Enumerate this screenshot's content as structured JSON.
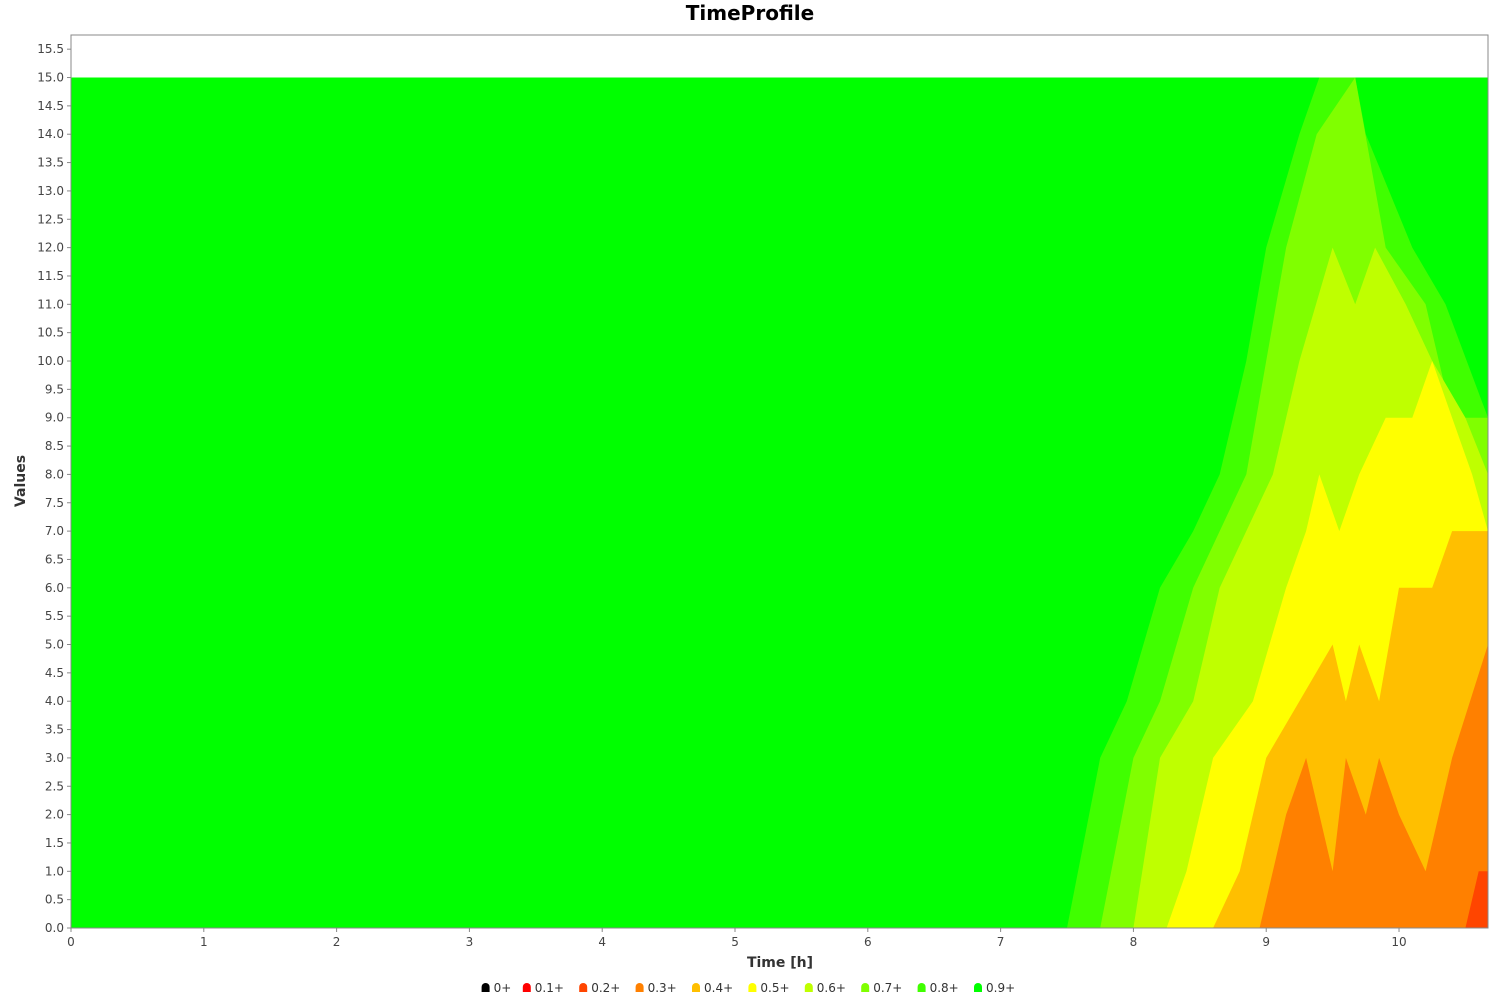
{
  "chart_data": {
    "type": "area",
    "title": "TimeProfile",
    "xlabel": "Time [h]",
    "ylabel": "Values",
    "xlim": [
      0,
      10.67
    ],
    "ylim": [
      0,
      15.75
    ],
    "xticks": [
      "0",
      "1",
      "2",
      "3",
      "4",
      "5",
      "6",
      "7",
      "8",
      "9",
      "10"
    ],
    "yticks": [
      "0.0",
      "0.5",
      "1.0",
      "1.5",
      "2.0",
      "2.5",
      "3.0",
      "3.5",
      "4.0",
      "4.5",
      "5.0",
      "5.5",
      "6.0",
      "6.5",
      "7.0",
      "7.5",
      "8.0",
      "8.5",
      "9.0",
      "9.5",
      "10.0",
      "10.5",
      "11.0",
      "11.5",
      "12.0",
      "12.5",
      "13.0",
      "13.5",
      "14.0",
      "14.5",
      "15.0",
      "15.5"
    ],
    "background_color": "#00ff00",
    "legend_position": "bottom",
    "legend": [
      {
        "label": "0+",
        "color": "#000000"
      },
      {
        "label": "0.1+",
        "color": "#ff0000"
      },
      {
        "label": "0.2+",
        "color": "#ff4500"
      },
      {
        "label": "0.3+",
        "color": "#ff8000"
      },
      {
        "label": "0.4+",
        "color": "#ffbf00"
      },
      {
        "label": "0.5+",
        "color": "#ffff00"
      },
      {
        "label": "0.6+",
        "color": "#bfff00"
      },
      {
        "label": "0.7+",
        "color": "#80ff00"
      },
      {
        "label": "0.8+",
        "color": "#40ff00"
      },
      {
        "label": "0.9+",
        "color": "#00ff00"
      }
    ],
    "series": [
      {
        "name": "0.9+",
        "color": "#00ff00",
        "points": [
          [
            0,
            0
          ],
          [
            0,
            15
          ],
          [
            10.67,
            15
          ],
          [
            10.67,
            0
          ]
        ]
      },
      {
        "name": "0.8+",
        "color": "#40ff00",
        "points": [
          [
            7.5,
            0
          ],
          [
            7.75,
            3
          ],
          [
            7.95,
            4
          ],
          [
            8.2,
            6
          ],
          [
            8.45,
            7
          ],
          [
            8.65,
            8
          ],
          [
            8.85,
            10
          ],
          [
            9.0,
            12
          ],
          [
            9.25,
            14
          ],
          [
            9.4,
            15
          ],
          [
            9.67,
            15
          ],
          [
            9.75,
            14
          ],
          [
            10.1,
            12
          ],
          [
            10.35,
            11
          ],
          [
            10.67,
            9
          ],
          [
            10.67,
            0
          ]
        ]
      },
      {
        "name": "0.7+",
        "color": "#80ff00",
        "points": [
          [
            7.75,
            0
          ],
          [
            8.0,
            3
          ],
          [
            8.2,
            4
          ],
          [
            8.45,
            6
          ],
          [
            8.65,
            7
          ],
          [
            8.85,
            8
          ],
          [
            9.0,
            10
          ],
          [
            9.15,
            12
          ],
          [
            9.38,
            14
          ],
          [
            9.67,
            15
          ],
          [
            9.9,
            12
          ],
          [
            10.2,
            11
          ],
          [
            10.4,
            9
          ],
          [
            10.67,
            9
          ],
          [
            10.67,
            0
          ]
        ]
      },
      {
        "name": "0.6+",
        "color": "#bfff00",
        "points": [
          [
            8.0,
            0
          ],
          [
            8.2,
            3
          ],
          [
            8.45,
            4
          ],
          [
            8.65,
            6
          ],
          [
            8.85,
            7
          ],
          [
            9.05,
            8
          ],
          [
            9.25,
            10
          ],
          [
            9.5,
            12
          ],
          [
            9.67,
            11
          ],
          [
            9.82,
            12
          ],
          [
            10.05,
            11
          ],
          [
            10.25,
            10
          ],
          [
            10.5,
            9
          ],
          [
            10.67,
            8
          ],
          [
            10.67,
            0
          ]
        ]
      },
      {
        "name": "0.5+",
        "color": "#ffff00",
        "points": [
          [
            8.25,
            0
          ],
          [
            8.4,
            1
          ],
          [
            8.6,
            3
          ],
          [
            8.9,
            4
          ],
          [
            9.15,
            6
          ],
          [
            9.3,
            7
          ],
          [
            9.4,
            8
          ],
          [
            9.55,
            7
          ],
          [
            9.7,
            8
          ],
          [
            9.9,
            9
          ],
          [
            10.1,
            9
          ],
          [
            10.25,
            10
          ],
          [
            10.4,
            9
          ],
          [
            10.55,
            8
          ],
          [
            10.67,
            7
          ],
          [
            10.67,
            0
          ]
        ]
      },
      {
        "name": "0.4+",
        "color": "#ffbf00",
        "points": [
          [
            8.6,
            0
          ],
          [
            8.8,
            1
          ],
          [
            9.0,
            3
          ],
          [
            9.25,
            4
          ],
          [
            9.5,
            5
          ],
          [
            9.6,
            4
          ],
          [
            9.7,
            5
          ],
          [
            9.85,
            4
          ],
          [
            10.0,
            6
          ],
          [
            10.25,
            6
          ],
          [
            10.4,
            7
          ],
          [
            10.67,
            7
          ],
          [
            10.67,
            0
          ]
        ]
      },
      {
        "name": "0.3+",
        "color": "#ff8000",
        "points": [
          [
            8.95,
            0
          ],
          [
            9.15,
            2
          ],
          [
            9.3,
            3
          ],
          [
            9.5,
            1
          ],
          [
            9.6,
            3
          ],
          [
            9.75,
            2
          ],
          [
            9.85,
            3
          ],
          [
            10.0,
            2
          ],
          [
            10.2,
            1
          ],
          [
            10.4,
            3
          ],
          [
            10.67,
            5
          ],
          [
            10.67,
            0
          ]
        ]
      },
      {
        "name": "0.2+",
        "color": "#ff4500",
        "points": [
          [
            10.5,
            0
          ],
          [
            10.6,
            1
          ],
          [
            10.67,
            1
          ],
          [
            10.67,
            0
          ]
        ]
      }
    ]
  }
}
